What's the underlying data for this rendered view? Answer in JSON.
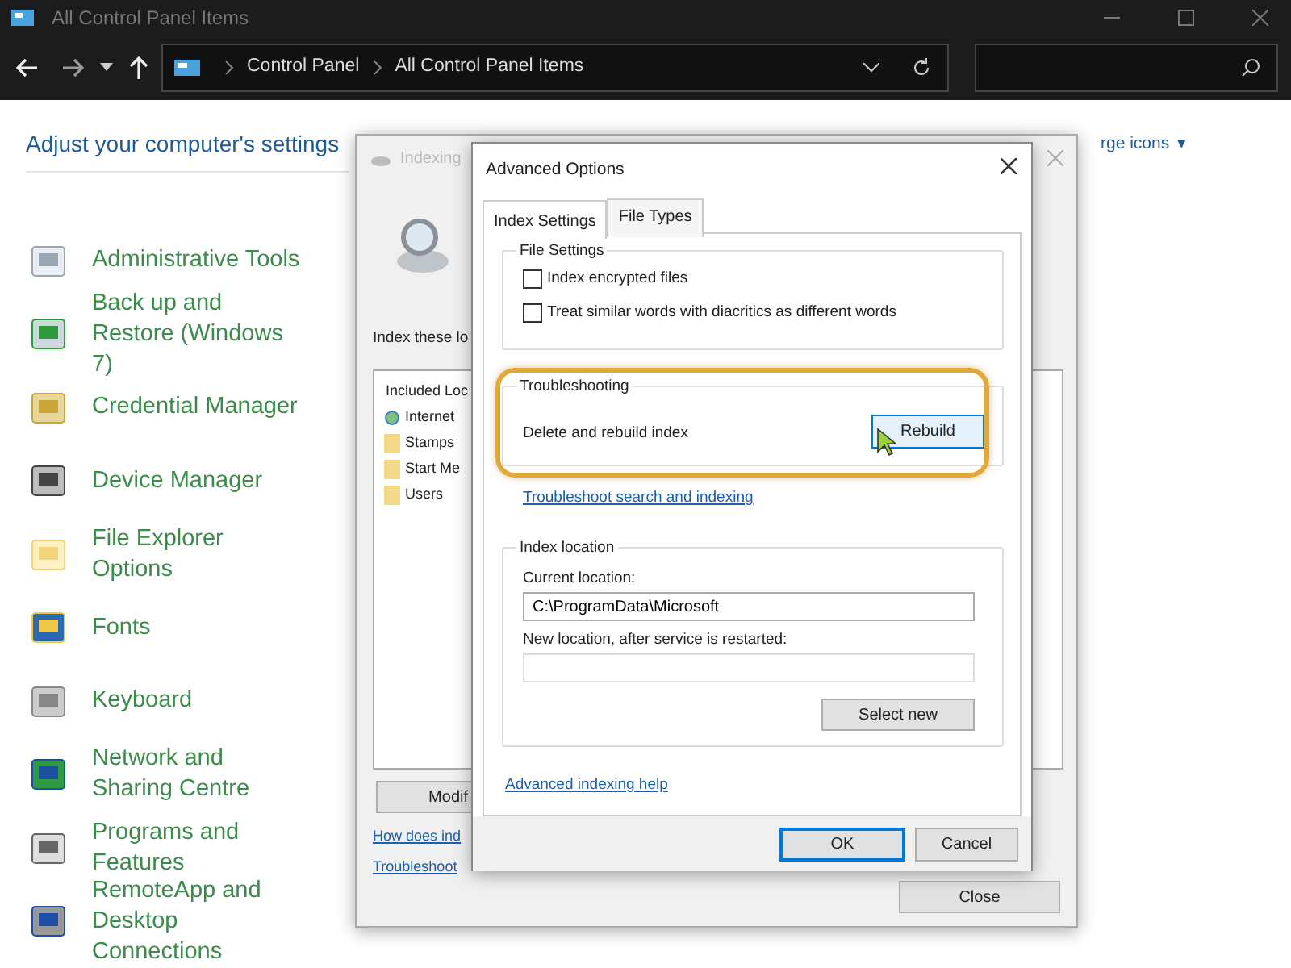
{
  "window": {
    "title": "All Control Panel Items",
    "breadcrumb": [
      "Control Panel",
      "All Control Panel Items"
    ]
  },
  "control_panel": {
    "heading": "Adjust your computer's settings",
    "view_by": "rge icons",
    "view_caret": "▾",
    "items": [
      {
        "label": "Administrative Tools"
      },
      {
        "label": "Back up and Restore (Windows 7)"
      },
      {
        "label": "Credential Manager"
      },
      {
        "label": "Device Manager"
      },
      {
        "label": "File Explorer Options"
      },
      {
        "label": "Fonts"
      },
      {
        "label": "Keyboard"
      },
      {
        "label": "Network and Sharing Centre"
      },
      {
        "label": "Programs and Features"
      },
      {
        "label": "RemoteApp and Desktop Connections"
      }
    ]
  },
  "indexing_window": {
    "title": "Indexing",
    "prompt": "Index these lo",
    "list_header": "Included Loc",
    "locations": [
      "Internet",
      "Stamps",
      "Start Me",
      "Users"
    ],
    "modify_button": "Modif",
    "links": [
      "How does ind",
      "Troubleshoot"
    ],
    "close_button": "Close"
  },
  "advanced_options": {
    "title": "Advanced Options",
    "tabs": [
      {
        "label": "Index Settings",
        "selected": true
      },
      {
        "label": "File Types",
        "selected": false
      }
    ],
    "file_settings": {
      "label": "File Settings",
      "options": [
        {
          "label": "Index encrypted files",
          "checked": false
        },
        {
          "label": "Treat similar words with diacritics as different words",
          "checked": false
        }
      ]
    },
    "troubleshooting": {
      "label": "Troubleshooting",
      "text": "Delete and rebuild index",
      "button": "Rebuild",
      "highlighted": true
    },
    "troubleshoot_link": "Troubleshoot search and indexing",
    "index_location": {
      "label": "Index location",
      "current_label": "Current location:",
      "current_value": "C:\\ProgramData\\Microsoft",
      "new_label": "New location, after service is restarted:",
      "select_button": "Select new"
    },
    "help_link": "Advanced indexing help",
    "buttons": [
      {
        "label": "OK",
        "default": true
      },
      {
        "label": "Cancel",
        "default": false
      }
    ]
  }
}
